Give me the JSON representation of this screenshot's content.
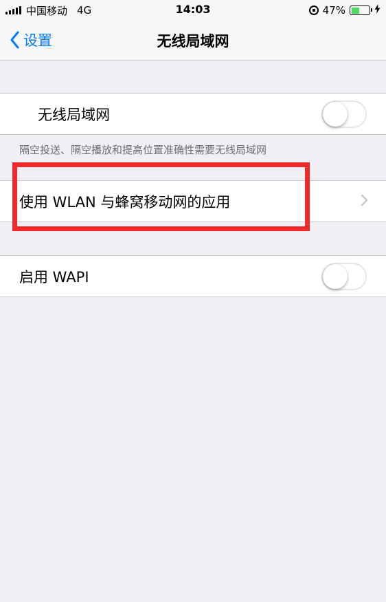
{
  "status_bar": {
    "carrier": "中国移动",
    "network": "4G",
    "time": "14:03",
    "battery_percent": "47%",
    "battery_level": 0.47,
    "icons": [
      "signal-icon",
      "rotation-lock-icon",
      "battery-icon",
      "charging-bolt-icon"
    ]
  },
  "nav": {
    "back_label": "设置",
    "title": "无线局域网"
  },
  "wlan_group": {
    "label": "无线局域网",
    "toggle_on": false,
    "footer": "隔空投送、隔空播放和提高位置准确性需要无线局域网"
  },
  "apps_group": {
    "label": "使用 WLAN 与蜂窝移动网的应用"
  },
  "wapi_group": {
    "label": "启用 WAPI",
    "toggle_on": false
  },
  "colors": {
    "accent": "#007aff",
    "annotation": "#f02a2a",
    "background": "#efeff4",
    "battery": "#4cd964"
  }
}
